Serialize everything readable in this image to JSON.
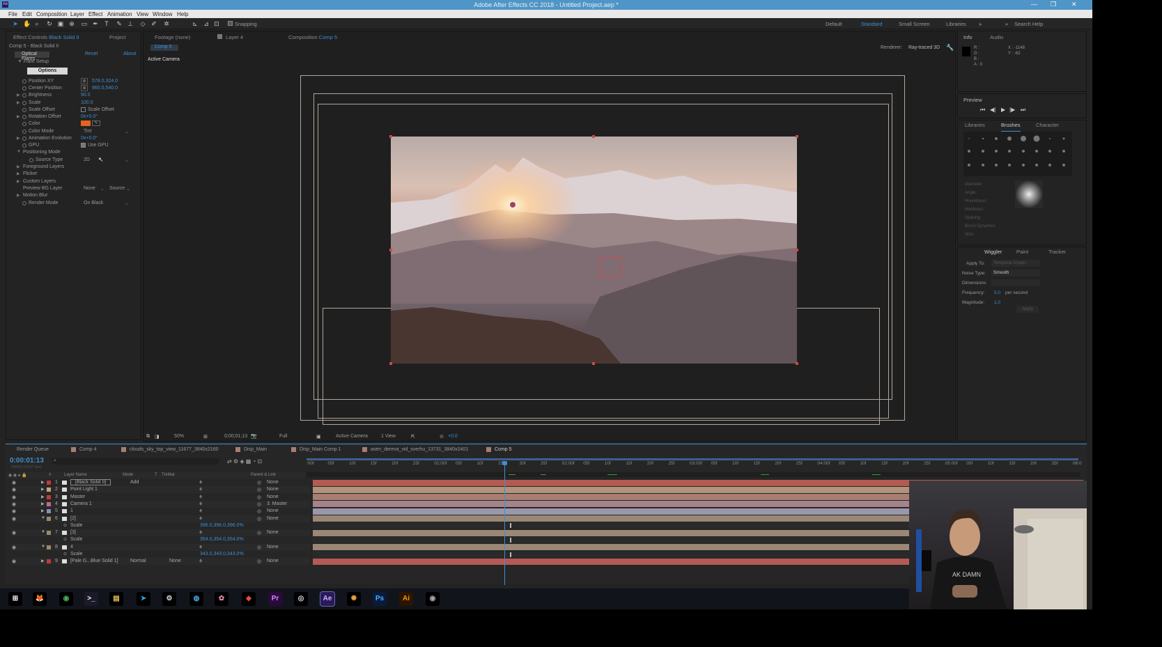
{
  "window": {
    "title": "Adobe After Effects CC 2018 - Untitled Project.aep *",
    "controls": [
      "—",
      "❐",
      "✕"
    ]
  },
  "menu": [
    "File",
    "Edit",
    "Composition",
    "Layer",
    "Effect",
    "Animation",
    "View",
    "Window",
    "Help"
  ],
  "toolbar": {
    "snapping": "Snapping",
    "workspaces": [
      "Default",
      "Standard",
      "Small Screen",
      "Libraries"
    ],
    "search": "Search Help"
  },
  "effect_panel": {
    "tab": "Effect Controls",
    "tab_layer": "Black Solid II",
    "project_tab": "Project",
    "layer_path": "Comp 5 - Black Solid II",
    "effect_name": "Optical Flares",
    "reset": "Reset",
    "about": "About",
    "flare_setup": "Flare Setup",
    "options_btn": "Options",
    "rows": [
      {
        "name": "Position XY",
        "value": "578.0,324.0"
      },
      {
        "name": "Center Position",
        "value": "960.0,540.0"
      },
      {
        "name": "Brightness",
        "value": "90.0"
      },
      {
        "name": "Scale",
        "value": "100.0"
      },
      {
        "name": "Scale Offset",
        "value": "Scale Offset"
      },
      {
        "name": "Rotation Offset",
        "value": "0x+0.0°"
      },
      {
        "name": "Color",
        "value": ""
      },
      {
        "name": "Color Mode",
        "value": "Tint"
      },
      {
        "name": "Animation Evolution",
        "value": "0x+0.0°"
      },
      {
        "name": "GPU",
        "value": "Use GPU"
      },
      {
        "name": "Positioning Mode",
        "value": ""
      },
      {
        "name": "Source Type",
        "value": "2D"
      },
      {
        "name": "Foreground Layers",
        "value": ""
      },
      {
        "name": "Flicker",
        "value": ""
      },
      {
        "name": "Custom Layers",
        "value": ""
      },
      {
        "name": "Preview BG Layer",
        "value": "None"
      },
      {
        "name": "Motion Blur",
        "value": ""
      },
      {
        "name": "Render Mode",
        "value": "On Black"
      }
    ],
    "preview_source": "Source"
  },
  "viewer": {
    "tabs": {
      "footage": "Footage (none)",
      "layer": "Layer 4",
      "comp": "Composition",
      "comp_name": "Comp 5"
    },
    "breadcrumb": "Comp 5",
    "active_camera": "Active Camera",
    "renderer_label": "Renderer:",
    "renderer": "Ray-traced 3D",
    "bottom": {
      "zoom": "50%",
      "time": "0;00;01;13",
      "res": "Full",
      "camera": "Active Camera",
      "views": "1 View",
      "exposure": "+0.0"
    }
  },
  "info_panel": {
    "tabs": [
      "Info",
      "Audio"
    ],
    "rgb": [
      "R :",
      "G :",
      "B :",
      "A : 0"
    ],
    "xy": [
      "X : -1148",
      "Y : -62"
    ]
  },
  "preview_panel": {
    "title": "Preview",
    "buttons": [
      "⏮",
      "◀|",
      "▶",
      "|▶",
      "⏭"
    ]
  },
  "brushes_panel": {
    "tabs": [
      "Libraries",
      "Brushes",
      "Character"
    ],
    "labels": [
      "Diameter:",
      "Angle:",
      "Roundness:",
      "Hardness:",
      "Spacing:",
      "Brush Dynamics",
      "Size:"
    ]
  },
  "wiggler_panel": {
    "tabs": [
      "Wiggler",
      "Paint",
      "Tracker"
    ],
    "apply_to": "Apply To:",
    "apply_val": "Temporal Graph",
    "noise_type": "Noise Type:",
    "noise_val": "Smooth",
    "dimensions": "Dimensions:",
    "frequency": "Frequency:",
    "freq_val": "5.0",
    "per_second": "per second",
    "magnitude": "Magnitude:",
    "mag_val": "1.0",
    "apply_btn": "Apply"
  },
  "timeline": {
    "tabs": [
      "Render Queue",
      "Comp 4",
      "clouds_sky_top_view_11677_3840x2160",
      "Disp_Main",
      "Disp_Main Comp 1",
      "asen_dereva_vid_sverhu_13731_3840x2401",
      "Comp 5"
    ],
    "timecode": "0:00:01:13",
    "fps": "00043 (29.97 fps)",
    "headers": {
      "num": "#",
      "name": "Layer Name",
      "mode": "Mode",
      "t": "T",
      "trkmat": "TrkMat",
      "parent": "Parent & Link"
    },
    "ruler": [
      ":00f",
      "05f",
      "10f",
      "15f",
      "20f",
      "25f",
      "01:00f",
      "05f",
      "10f",
      "15f",
      "20f",
      "25f",
      "02:00f",
      "05f",
      "10f",
      "15f",
      "20f",
      "25f",
      "03:00f",
      "05f",
      "10f",
      "15f",
      "20f",
      "25f",
      "04:00f",
      "05f",
      "10f",
      "15f",
      "20f",
      "25f",
      "05:00f",
      "05f",
      "10f",
      "15f",
      "20f",
      "25f",
      "06:0"
    ],
    "layers": [
      {
        "num": "1",
        "name": "[Black Solid II]",
        "mode": "Add",
        "trk": "",
        "parent": "None",
        "color": "#c03a3a",
        "bar": "#b45a55"
      },
      {
        "num": "2",
        "name": "Point Light 1",
        "mode": "",
        "trk": "",
        "parent": "None",
        "color": "#caa37a",
        "bar": "#b3947a"
      },
      {
        "num": "3",
        "name": "Master",
        "mode": "",
        "trk": "",
        "parent": "None",
        "color": "#c03a3a",
        "bar": "#a67e73"
      },
      {
        "num": "4",
        "name": "Camera 1",
        "mode": "",
        "trk": "",
        "parent": "3. Master",
        "color": "#c06a8a",
        "bar": "#a5838a"
      },
      {
        "num": "5",
        "name": "1",
        "mode": "",
        "trk": "",
        "parent": "None",
        "color": "#8a8ac0",
        "bar": "#9a97ab"
      },
      {
        "num": "6",
        "name": "[2]",
        "mode": "",
        "trk": "",
        "parent": "None",
        "color": "#9a8a6a",
        "bar": "#9a8775"
      },
      {
        "num": "",
        "name": "Scale",
        "mode": "",
        "trk": "",
        "parent": "",
        "color": "",
        "bar": "",
        "val": "396.0,396.0,396.0%"
      },
      {
        "num": "7",
        "name": "[3]",
        "mode": "",
        "trk": "",
        "parent": "None",
        "color": "#9a8a6a",
        "bar": "#9a8775"
      },
      {
        "num": "",
        "name": "Scale",
        "mode": "",
        "trk": "",
        "parent": "",
        "color": "",
        "bar": "",
        "val": "354.0,354.0,354.0%"
      },
      {
        "num": "8",
        "name": "4",
        "mode": "",
        "trk": "",
        "parent": "None",
        "color": "#9a8a6a",
        "bar": "#9a8775"
      },
      {
        "num": "",
        "name": "Scale",
        "mode": "",
        "trk": "",
        "parent": "",
        "color": "",
        "bar": "",
        "val": "343.0,343.0,343.0%"
      },
      {
        "num": "9",
        "name": "[Pale G...Blue Solid 1]",
        "mode": "Normal",
        "trk": "None",
        "parent": "None",
        "color": "#c03a3a",
        "bar": "#b45a55"
      }
    ]
  },
  "taskbar": {
    "apps": [
      {
        "name": "windows-start",
        "label": "⊞",
        "bg": "#000",
        "fg": "#fff"
      },
      {
        "name": "firefox",
        "label": "🦊",
        "bg": "#000",
        "fg": "#e66000"
      },
      {
        "name": "chrome",
        "label": "◉",
        "bg": "#000",
        "fg": "#4caf50"
      },
      {
        "name": "terminal",
        "label": ">_",
        "bg": "#1a1a2a",
        "fg": "#fff"
      },
      {
        "name": "file-explorer",
        "label": "▤",
        "bg": "#000",
        "fg": "#e5c15b"
      },
      {
        "name": "telegram",
        "label": "➤",
        "bg": "#000",
        "fg": "#2aa3df"
      },
      {
        "name": "steam",
        "label": "⚙",
        "bg": "#000",
        "fg": "#cfd8e0"
      },
      {
        "name": "browser",
        "label": "◍",
        "bg": "#000",
        "fg": "#4aa3df"
      },
      {
        "name": "app-pink",
        "label": "✿",
        "bg": "#000",
        "fg": "#e08aa8"
      },
      {
        "name": "app-red",
        "label": "◆",
        "bg": "#000",
        "fg": "#e0503a"
      },
      {
        "name": "premiere",
        "label": "Pr",
        "bg": "#2a0a3a",
        "fg": "#d48aff"
      },
      {
        "name": "obs",
        "label": "◎",
        "bg": "#000",
        "fg": "#ddd"
      },
      {
        "name": "after-effects",
        "label": "Ae",
        "bg": "#2a1a5a",
        "fg": "#c9b3ff"
      },
      {
        "name": "app-cinema",
        "label": "✺",
        "bg": "#000",
        "fg": "#e0a040"
      },
      {
        "name": "photoshop",
        "label": "Ps",
        "bg": "#0a1a3a",
        "fg": "#4ab0ff"
      },
      {
        "name": "illustrator",
        "label": "Ai",
        "bg": "#2a1500",
        "fg": "#ff9a00"
      },
      {
        "name": "steam-alt",
        "label": "◉",
        "bg": "#000",
        "fg": "#aaa"
      }
    ]
  }
}
